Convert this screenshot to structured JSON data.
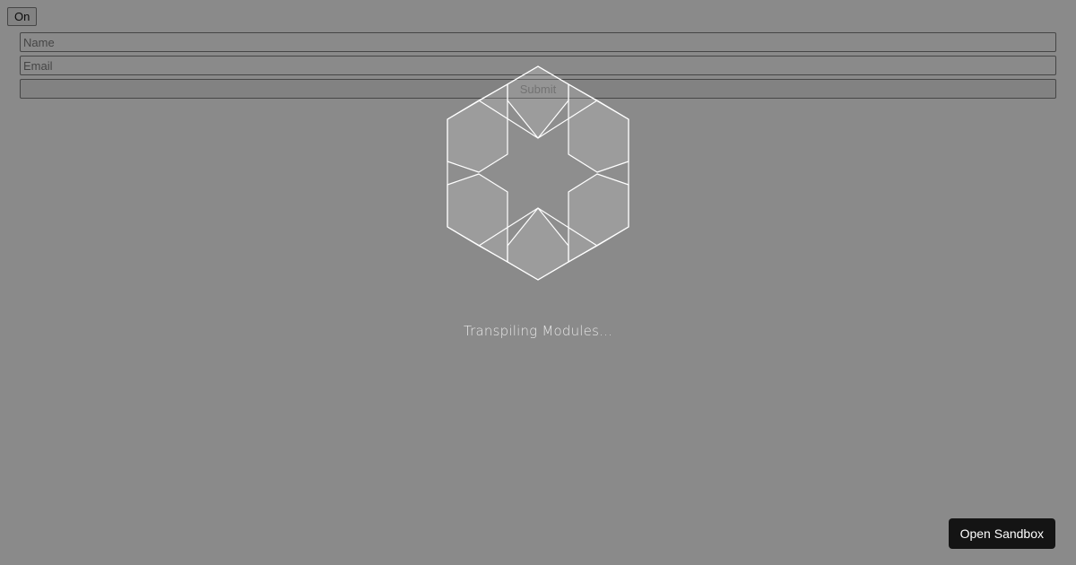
{
  "app": {
    "toggle_label": "On",
    "form": {
      "name_placeholder": "Name",
      "email_placeholder": "Email",
      "submit_label": "Submit"
    }
  },
  "overlay": {
    "logo_icon": "codesandbox-hexagon-logo-icon",
    "status_text": "Transpiling Modules...",
    "open_sandbox_label": "Open Sandbox"
  },
  "colors": {
    "overlay": "#8c8c8c",
    "button_dark": "#141414",
    "logo_stroke": "#ffffff"
  }
}
